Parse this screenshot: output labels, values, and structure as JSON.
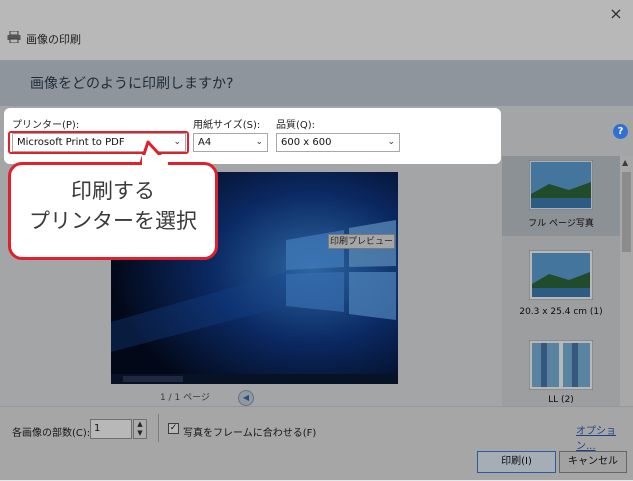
{
  "window": {
    "title": "画像の印刷",
    "close_label": "×"
  },
  "header": {
    "question": "画像をどのように印刷しますか?"
  },
  "printer": {
    "label": "プリンター(P):",
    "value": "Microsoft Print to PDF"
  },
  "paper_size": {
    "label": "用紙サイズ(S):",
    "value": "A4"
  },
  "quality": {
    "label": "品質(Q):",
    "value": "600 x 600"
  },
  "help": {
    "label": "?"
  },
  "callout": {
    "line1": "印刷する",
    "line2": "プリンターを選択"
  },
  "preview": {
    "tag": "印刷プレビュー",
    "pager": "1 / 1 ページ"
  },
  "layouts": [
    {
      "label": "フル ページ写真",
      "selected": true
    },
    {
      "label": "20.3 x 25.4 cm (1)",
      "selected": false
    },
    {
      "label": "LL (2)",
      "selected": false
    }
  ],
  "bottom": {
    "copies_label": "各画像の部数(C):",
    "copies_value": "1",
    "fit_label": "写真をフレームに合わせる(F)",
    "fit_checked": true,
    "options_link": "オプション...",
    "print_button": "印刷(I)",
    "cancel_button": "キャンセル"
  },
  "colors": {
    "accent_red": "#e0202c",
    "header_bg": "#c5cfd9",
    "link_blue": "#2a5db8"
  }
}
